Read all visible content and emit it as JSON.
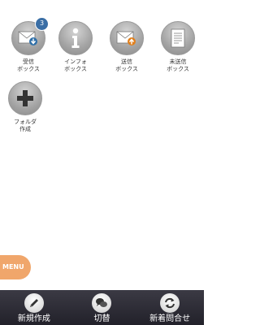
{
  "folders": [
    {
      "label": "受信\nボックス",
      "icon": "inbox-envelope-icon",
      "badge": "3"
    },
    {
      "label": "インフォ\nボックス",
      "icon": "info-icon"
    },
    {
      "label": "送信\nボックス",
      "icon": "outbox-envelope-icon"
    },
    {
      "label": "未送信\nボックス",
      "icon": "draft-document-icon"
    },
    {
      "label": "フォルダ\n作成",
      "icon": "plus-icon"
    }
  ],
  "menu": {
    "label": "MENU",
    "color": "#f0a66b"
  },
  "toolbar": {
    "items": [
      {
        "label": "新規作成",
        "icon": "pencil-icon"
      },
      {
        "label": "切替",
        "icon": "chat-bubbles-icon"
      },
      {
        "label": "新着問合せ",
        "icon": "refresh-arrows-icon"
      }
    ],
    "background": "#2e2d36"
  },
  "colors": {
    "badge": "#3a6ea5",
    "incoming_arrow": "#2f6fa8",
    "outgoing_arrow": "#e07f1c"
  }
}
